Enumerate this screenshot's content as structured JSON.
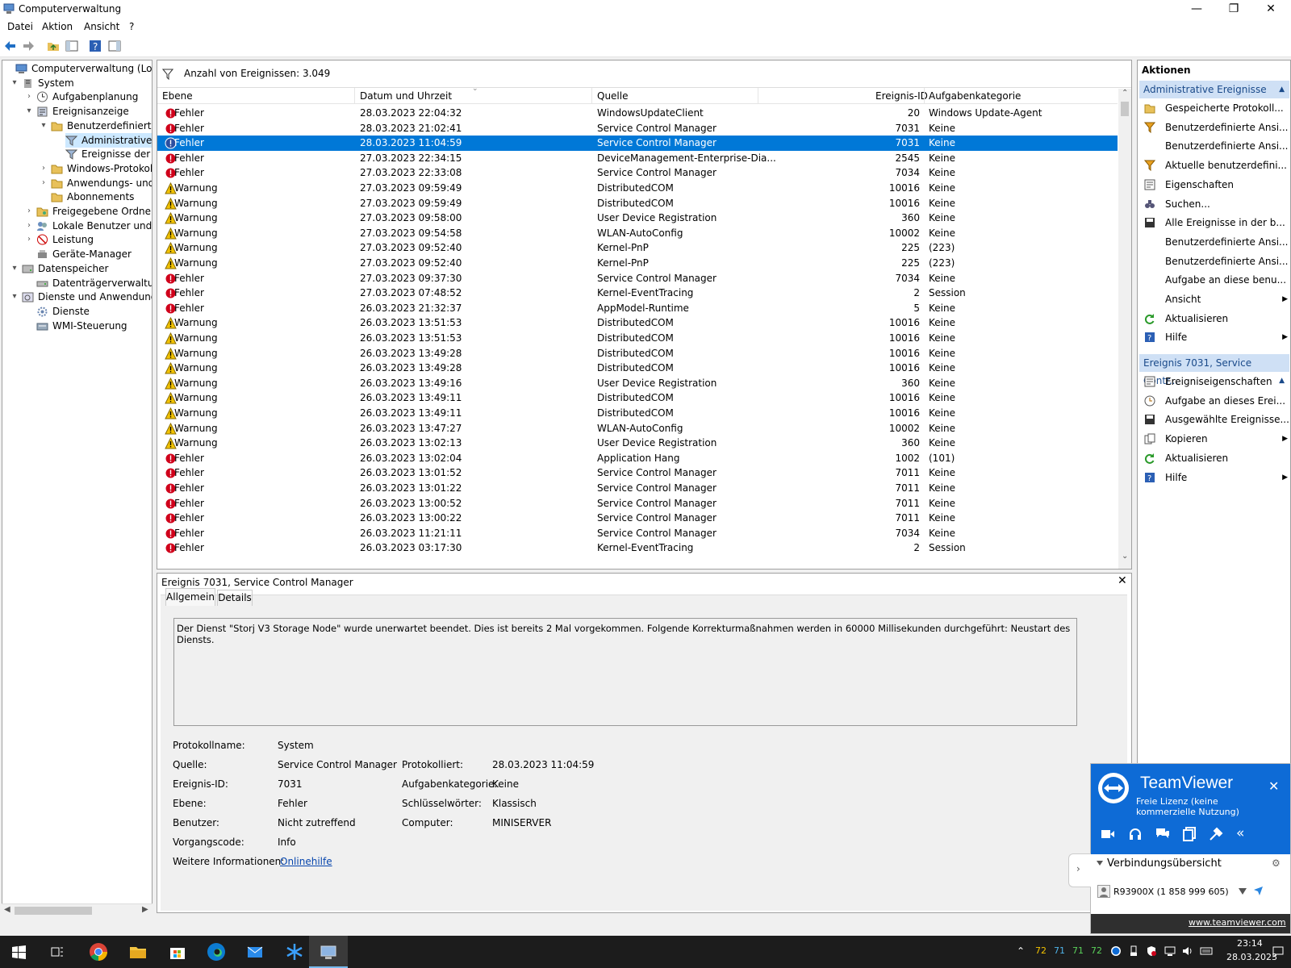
{
  "window": {
    "title": "Computerverwaltung"
  },
  "menu": [
    "Datei",
    "Aktion",
    "Ansicht",
    "?"
  ],
  "tree": [
    {
      "label": "Computerverwaltung (Lokal)",
      "exp": ""
    },
    {
      "label": "System",
      "exp": "▾"
    },
    {
      "label": "Aufgabenplanung",
      "exp": "›"
    },
    {
      "label": "Ereignisanzeige",
      "exp": "▾"
    },
    {
      "label": "Benutzerdefinierte A",
      "exp": "▾"
    },
    {
      "label": "Administrative E",
      "exp": ""
    },
    {
      "label": "Ereignisse der Zu",
      "exp": ""
    },
    {
      "label": "Windows-Protokolle",
      "exp": "›"
    },
    {
      "label": "Anwendungs- und D",
      "exp": "›"
    },
    {
      "label": "Abonnements",
      "exp": ""
    },
    {
      "label": "Freigegebene Ordner",
      "exp": "›"
    },
    {
      "label": "Lokale Benutzer und Gr",
      "exp": "›"
    },
    {
      "label": "Leistung",
      "exp": "›"
    },
    {
      "label": "Geräte-Manager",
      "exp": ""
    },
    {
      "label": "Datenspeicher",
      "exp": "▾"
    },
    {
      "label": "Datenträgerverwaltung",
      "exp": ""
    },
    {
      "label": "Dienste und Anwendungen",
      "exp": "▾"
    },
    {
      "label": "Dienste",
      "exp": ""
    },
    {
      "label": "WMI-Steuerung",
      "exp": ""
    }
  ],
  "filter": {
    "count_label": "Anzahl von Ereignissen: 3.049"
  },
  "columns": {
    "level": "Ebene",
    "date": "Datum und Uhrzeit",
    "source": "Quelle",
    "id": "Ereignis-ID",
    "category": "Aufgabenkategorie"
  },
  "events": [
    {
      "level": "Fehler",
      "date": "28.03.2023 22:04:32",
      "source": "WindowsUpdateClient",
      "id": "20",
      "category": "Windows Update-Agent"
    },
    {
      "level": "Fehler",
      "date": "28.03.2023 21:02:41",
      "source": "Service Control Manager",
      "id": "7031",
      "category": "Keine"
    },
    {
      "level": "Fehler",
      "date": "28.03.2023 11:04:59",
      "source": "Service Control Manager",
      "id": "7031",
      "category": "Keine"
    },
    {
      "level": "Fehler",
      "date": "27.03.2023 22:34:15",
      "source": "DeviceManagement-Enterprise-Dia...",
      "id": "2545",
      "category": "Keine"
    },
    {
      "level": "Fehler",
      "date": "27.03.2023 22:33:08",
      "source": "Service Control Manager",
      "id": "7034",
      "category": "Keine"
    },
    {
      "level": "Warnung",
      "date": "27.03.2023 09:59:49",
      "source": "DistributedCOM",
      "id": "10016",
      "category": "Keine"
    },
    {
      "level": "Warnung",
      "date": "27.03.2023 09:59:49",
      "source": "DistributedCOM",
      "id": "10016",
      "category": "Keine"
    },
    {
      "level": "Warnung",
      "date": "27.03.2023 09:58:00",
      "source": "User Device Registration",
      "id": "360",
      "category": "Keine"
    },
    {
      "level": "Warnung",
      "date": "27.03.2023 09:54:58",
      "source": "WLAN-AutoConfig",
      "id": "10002",
      "category": "Keine"
    },
    {
      "level": "Warnung",
      "date": "27.03.2023 09:52:40",
      "source": "Kernel-PnP",
      "id": "225",
      "category": "(223)"
    },
    {
      "level": "Warnung",
      "date": "27.03.2023 09:52:40",
      "source": "Kernel-PnP",
      "id": "225",
      "category": "(223)"
    },
    {
      "level": "Fehler",
      "date": "27.03.2023 09:37:30",
      "source": "Service Control Manager",
      "id": "7034",
      "category": "Keine"
    },
    {
      "level": "Fehler",
      "date": "27.03.2023 07:48:52",
      "source": "Kernel-EventTracing",
      "id": "2",
      "category": "Session"
    },
    {
      "level": "Fehler",
      "date": "26.03.2023 21:32:37",
      "source": "AppModel-Runtime",
      "id": "5",
      "category": "Keine"
    },
    {
      "level": "Warnung",
      "date": "26.03.2023 13:51:53",
      "source": "DistributedCOM",
      "id": "10016",
      "category": "Keine"
    },
    {
      "level": "Warnung",
      "date": "26.03.2023 13:51:53",
      "source": "DistributedCOM",
      "id": "10016",
      "category": "Keine"
    },
    {
      "level": "Warnung",
      "date": "26.03.2023 13:49:28",
      "source": "DistributedCOM",
      "id": "10016",
      "category": "Keine"
    },
    {
      "level": "Warnung",
      "date": "26.03.2023 13:49:28",
      "source": "DistributedCOM",
      "id": "10016",
      "category": "Keine"
    },
    {
      "level": "Warnung",
      "date": "26.03.2023 13:49:16",
      "source": "User Device Registration",
      "id": "360",
      "category": "Keine"
    },
    {
      "level": "Warnung",
      "date": "26.03.2023 13:49:11",
      "source": "DistributedCOM",
      "id": "10016",
      "category": "Keine"
    },
    {
      "level": "Warnung",
      "date": "26.03.2023 13:49:11",
      "source": "DistributedCOM",
      "id": "10016",
      "category": "Keine"
    },
    {
      "level": "Warnung",
      "date": "26.03.2023 13:47:27",
      "source": "WLAN-AutoConfig",
      "id": "10002",
      "category": "Keine"
    },
    {
      "level": "Warnung",
      "date": "26.03.2023 13:02:13",
      "source": "User Device Registration",
      "id": "360",
      "category": "Keine"
    },
    {
      "level": "Fehler",
      "date": "26.03.2023 13:02:04",
      "source": "Application Hang",
      "id": "1002",
      "category": "(101)"
    },
    {
      "level": "Fehler",
      "date": "26.03.2023 13:01:52",
      "source": "Service Control Manager",
      "id": "7011",
      "category": "Keine"
    },
    {
      "level": "Fehler",
      "date": "26.03.2023 13:01:22",
      "source": "Service Control Manager",
      "id": "7011",
      "category": "Keine"
    },
    {
      "level": "Fehler",
      "date": "26.03.2023 13:00:52",
      "source": "Service Control Manager",
      "id": "7011",
      "category": "Keine"
    },
    {
      "level": "Fehler",
      "date": "26.03.2023 13:00:22",
      "source": "Service Control Manager",
      "id": "7011",
      "category": "Keine"
    },
    {
      "level": "Fehler",
      "date": "26.03.2023 11:21:11",
      "source": "Service Control Manager",
      "id": "7034",
      "category": "Keine"
    },
    {
      "level": "Fehler",
      "date": "26.03.2023 03:17:30",
      "source": "Kernel-EventTracing",
      "id": "2",
      "category": "Session"
    }
  ],
  "selected_row": 2,
  "detail": {
    "title": "Ereignis 7031, Service Control Manager",
    "tab_general": "Allgemein",
    "tab_details": "Details",
    "message": "Der Dienst \"Storj V3 Storage Node\" wurde unerwartet beendet. Dies ist bereits 2 Mal vorgekommen. Folgende Korrekturmaßnahmen werden in 60000 Millisekunden durchgeführt: Neustart des Diensts.",
    "log_name_label": "Protokollname:",
    "log_name": "System",
    "source_label": "Quelle:",
    "source": "Service Control Manager",
    "logged_label": "Protokolliert:",
    "logged": "28.03.2023 11:04:59",
    "event_id_label": "Ereignis-ID:",
    "event_id": "7031",
    "task_label": "Aufgabenkategorie:",
    "task": "Keine",
    "level_label": "Ebene:",
    "level": "Fehler",
    "keywords_label": "Schlüsselwörter:",
    "keywords": "Klassisch",
    "user_label": "Benutzer:",
    "user": "Nicht zutreffend",
    "computer_label": "Computer:",
    "computer": "MINISERVER",
    "opcode_label": "Vorgangscode:",
    "opcode": "Info",
    "more_label": "Weitere Informationen:",
    "more_link": "Onlinehilfe"
  },
  "actions": {
    "title": "Aktionen",
    "section1": "Administrative Ereignisse",
    "items1": [
      {
        "label": "Gespeicherte Protokoll...",
        "icon": "folder-open-icon",
        "sub": false
      },
      {
        "label": "Benutzerdefinierte Ansi...",
        "icon": "filter-icon",
        "sub": false
      },
      {
        "label": "Benutzerdefinierte Ansi...",
        "icon": "",
        "sub": false
      },
      {
        "label": "Aktuelle benutzerdefini...",
        "icon": "filter-icon",
        "sub": false
      },
      {
        "label": "Eigenschaften",
        "icon": "properties-icon",
        "sub": false
      },
      {
        "label": "Suchen...",
        "icon": "binoculars-icon",
        "sub": false
      },
      {
        "label": "Alle Ereignisse in der b...",
        "icon": "save-icon",
        "sub": false
      },
      {
        "label": "Benutzerdefinierte Ansi...",
        "icon": "",
        "sub": false
      },
      {
        "label": "Benutzerdefinierte Ansi...",
        "icon": "",
        "sub": false
      },
      {
        "label": "Aufgabe an diese benu...",
        "icon": "",
        "sub": false
      },
      {
        "label": "Ansicht",
        "icon": "",
        "sub": true
      },
      {
        "label": "Aktualisieren",
        "icon": "refresh-icon",
        "sub": false
      },
      {
        "label": "Hilfe",
        "icon": "help-icon",
        "sub": true
      }
    ],
    "section2": "Ereignis 7031, Service Contr...",
    "items2": [
      {
        "label": "Ereigniseigenschaften",
        "icon": "properties-icon",
        "sub": false
      },
      {
        "label": "Aufgabe an dieses Erei...",
        "icon": "task-icon",
        "sub": false
      },
      {
        "label": "Ausgewählte Ereignisse...",
        "icon": "save-icon",
        "sub": false
      },
      {
        "label": "Kopieren",
        "icon": "copy-icon",
        "sub": true
      },
      {
        "label": "Aktualisieren",
        "icon": "refresh-icon",
        "sub": false
      },
      {
        "label": "Hilfe",
        "icon": "help-icon",
        "sub": true
      }
    ]
  },
  "teamviewer": {
    "brand": "TeamViewer",
    "license": "Freie Lizenz (keine kommerzielle Nutzung)",
    "overview": "Verbindungsübersicht",
    "connection": "R93900X (1 858 999 605)",
    "url": "www.teamviewer.com"
  },
  "tray": {
    "temps": [
      "72",
      "71",
      "71",
      "72"
    ],
    "time": "23:14",
    "date": "28.03.2023"
  },
  "colors": {
    "selection": "#0078d7",
    "error": "#d0021b",
    "warning": "#f2c200",
    "teamviewer": "#0e6bd6",
    "section": "#cfe0f5"
  }
}
